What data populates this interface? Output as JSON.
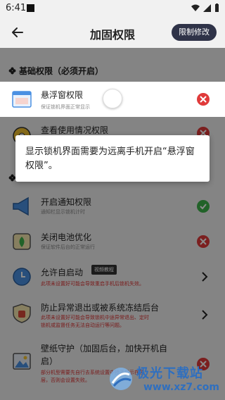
{
  "status_bar": {
    "time": "6:41"
  },
  "header": {
    "title": "加固权限",
    "limit_button": "限制修改"
  },
  "section": {
    "title": "基础权限（必须开启）"
  },
  "items": [
    {
      "title": "悬浮窗权限",
      "subtitle": "保证锁机界面正常显示",
      "status": "bad"
    },
    {
      "title": "查看使用情况权限",
      "subtitle": "",
      "status": "bad"
    },
    {
      "title": "开启通知权限",
      "subtitle": "通知栏显示锁机计时",
      "status": "ok"
    },
    {
      "title": "关闭电池优化",
      "subtitle": "保证软件后台的正常运行",
      "status": "bad"
    },
    {
      "title": "允许自启动",
      "subtitle": "此项未设置好可能会导致重启手机后锁机失效。",
      "badge": "视频教程",
      "status": "arrow"
    },
    {
      "title": "防止异常退出或被系统冻结后台",
      "subtitle_line1": "此项未设置好可能会导致锁机中途异常退出、定时",
      "subtitle_line2": "锁机或监督任务无法自动运行等问题。",
      "status": "arrow"
    },
    {
      "title_line1": "壁纸守护（加固后台，加快开机自",
      "title_line2": "启）",
      "subtitle_line1": "部分机型需要先自行去系统设置中授予显示在顶",
      "subtitle_line2": "层，否则会设置失败。",
      "status": "bad"
    }
  ],
  "dialog": {
    "message": "显示锁机界面需要为远离手机开启“悬浮窗权限”。"
  },
  "watermark": {
    "line1": "极光下载站",
    "line2": "www.xz7.com"
  },
  "colors": {
    "accent": "#2f3348",
    "bad": "#e03a3a",
    "ok": "#3cb34a"
  }
}
